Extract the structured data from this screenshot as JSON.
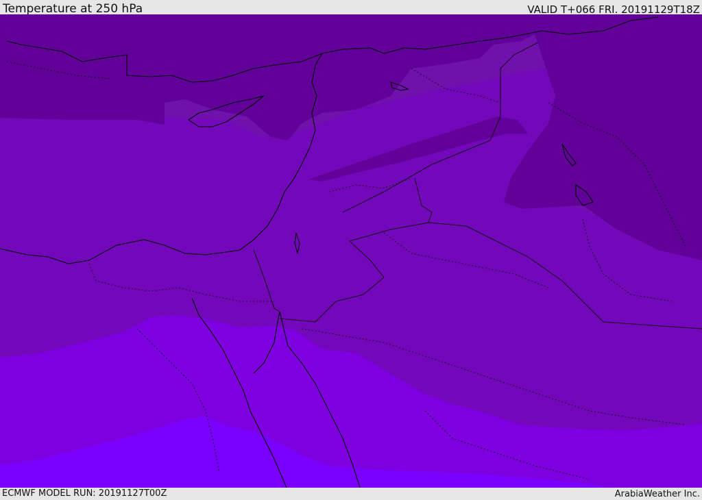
{
  "header": {
    "title": "Temperature at 250 hPa",
    "valid": "VALID T+066 FRI. 20191129T18Z"
  },
  "footer": {
    "model_run": "ECMWF MODEL RUN: 20191127T00Z",
    "credit": "ArabiaWeather Inc."
  },
  "map": {
    "region": "Eastern Mediterranean and Middle East",
    "colors": {
      "band_coldest": "#62009a",
      "band_cold": "#7010ad",
      "band_mid": "#7208b9",
      "band_warm": "#7e00e0",
      "band_warmest": "#7900ff",
      "coastline": "#000000",
      "border": "#111111"
    }
  }
}
